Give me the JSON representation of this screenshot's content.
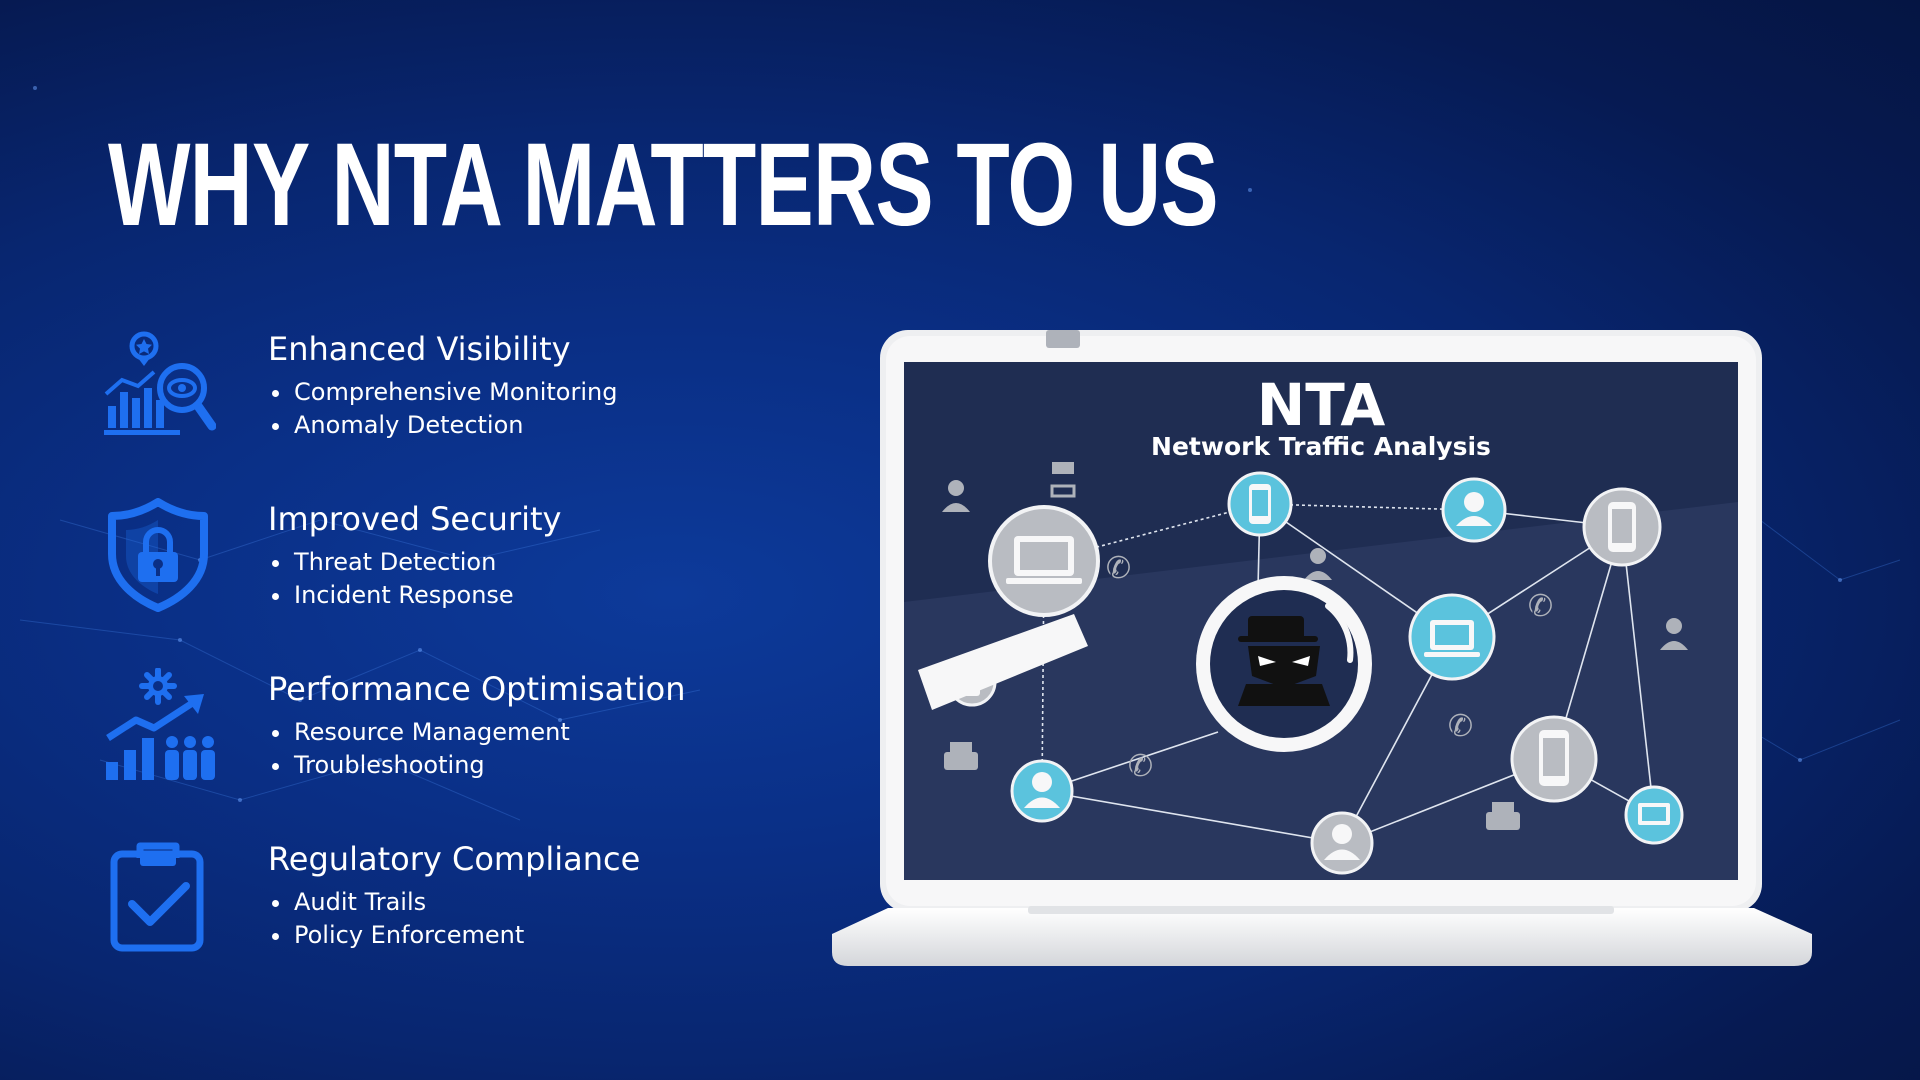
{
  "slide": {
    "title": "WHY NTA MATTERS TO US"
  },
  "features": [
    {
      "title": "Enhanced Visibility",
      "icon": "analytics-magnifier-icon",
      "items": [
        "Comprehensive Monitoring",
        "Anomaly Detection"
      ]
    },
    {
      "title": "Improved Security",
      "icon": "shield-lock-icon",
      "items": [
        "Threat Detection",
        "Incident Response"
      ]
    },
    {
      "title": "Performance Optimisation",
      "icon": "performance-growth-icon",
      "items": [
        "Resource Management",
        "Troubleshooting"
      ]
    },
    {
      "title": "Regulatory Compliance",
      "icon": "clipboard-check-icon",
      "items": [
        "Audit Trails",
        "Policy Enforcement"
      ]
    }
  ],
  "laptop_screen": {
    "headline": "NTA",
    "subheadline": "Network Traffic Analysis"
  },
  "colors": {
    "icon_blue": "#1e6ff0",
    "node_cyan": "#5bc3dd",
    "node_grey": "#b9bcc2",
    "screen_bg": "#1f2d52"
  }
}
